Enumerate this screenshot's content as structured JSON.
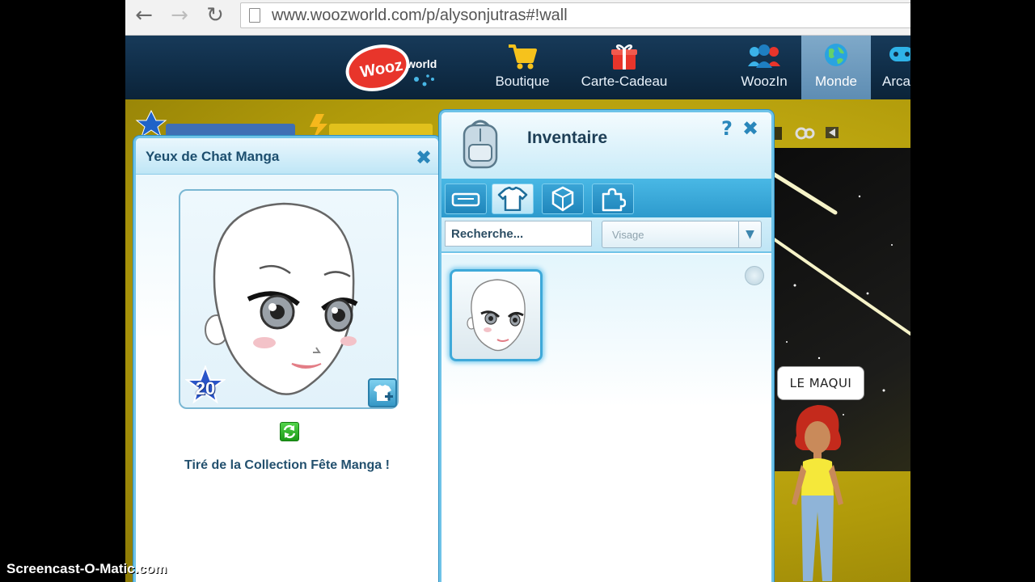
{
  "browser": {
    "url": "www.woozworld.com/p/alysonjutras#!wall",
    "back_icon": "arrow-left-icon",
    "forward_icon": "arrow-right-icon",
    "reload_icon": "reload-icon"
  },
  "header": {
    "logo_text": "Wooz",
    "logo_sub": "world",
    "nav": [
      {
        "label": "Boutique",
        "icon": "shopping-cart-icon"
      },
      {
        "label": "Carte-Cadeau",
        "icon": "gift-icon"
      },
      {
        "label": "WoozIn",
        "icon": "people-icon"
      },
      {
        "label": "Monde",
        "icon": "globe-icon",
        "active": true
      },
      {
        "label": "Arca",
        "icon": "gamepad-icon"
      }
    ]
  },
  "item_panel": {
    "title": "Yeux de Chat Manga",
    "level": "20",
    "collection_text": "Tiré de la Collection Fête Manga !"
  },
  "inventory": {
    "title": "Inventaire",
    "search_placeholder": "Recherche...",
    "category": "Visage",
    "tabs": [
      "sofa-icon",
      "shirt-icon",
      "box-icon",
      "puzzle-icon"
    ]
  },
  "game": {
    "speech_bubble": "LE MAQUI"
  },
  "watermark": "Screencast-O-Matic.com",
  "colors": {
    "header_bg": "#0f2c46",
    "panel_border": "#6fc3e8",
    "game_bg": "#c7ad12"
  }
}
